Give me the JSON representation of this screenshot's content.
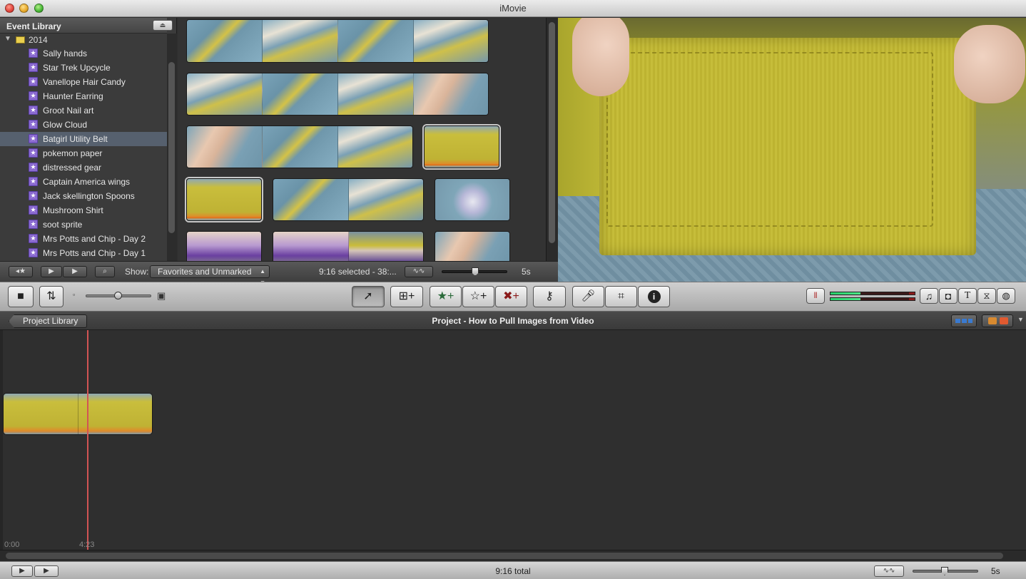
{
  "window": {
    "title": "iMovie"
  },
  "event_library": {
    "header": "Event Library",
    "year": "2014",
    "items": [
      {
        "label": "Sally hands"
      },
      {
        "label": "Star Trek Upcycle"
      },
      {
        "label": "Vanellope Hair Candy"
      },
      {
        "label": "Haunter Earring"
      },
      {
        "label": "Groot Nail art"
      },
      {
        "label": "Glow Cloud"
      },
      {
        "label": "Batgirl Utility Belt",
        "selected": true
      },
      {
        "label": "pokemon paper"
      },
      {
        "label": "distressed gear"
      },
      {
        "label": "Captain America wings"
      },
      {
        "label": "Jack skellington Spoons"
      },
      {
        "label": "Mushroom Shirt"
      },
      {
        "label": "soot sprite"
      },
      {
        "label": "Mrs Potts and Chip - Day 2"
      },
      {
        "label": "Mrs Potts and Chip - Day 1"
      }
    ]
  },
  "browser_bar": {
    "show_label": "Show:",
    "show_value": "Favorites and Unmarked",
    "selected_info": "9:16 selected - 38:...",
    "duration": "5s"
  },
  "project": {
    "library_button": "Project Library",
    "title": "Project - How to Pull Images from Video",
    "timecode_start": "0:00",
    "timecode_playhead": "4:23"
  },
  "status": {
    "total": "9:16 total",
    "duration": "5s"
  },
  "colors": {
    "accent_selection": "#56606e",
    "playhead": "#d25454",
    "meter_green": "#26d06a",
    "favorite_marker": "#e07820"
  }
}
